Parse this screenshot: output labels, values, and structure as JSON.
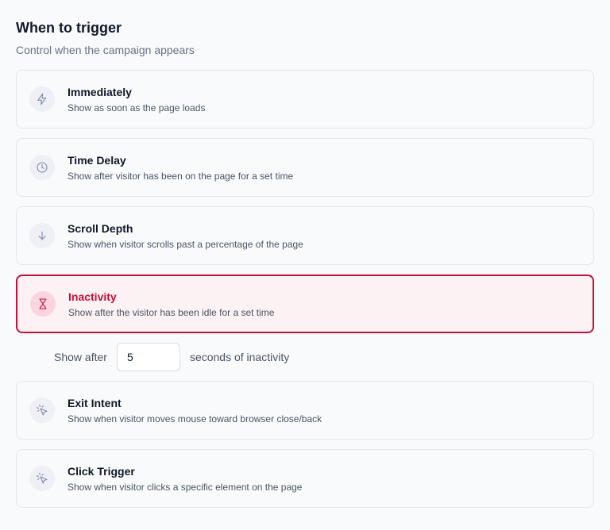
{
  "header": {
    "title": "When to trigger",
    "subtitle": "Control when the campaign appears"
  },
  "options": [
    {
      "id": "immediately",
      "icon": "lightning-icon",
      "title": "Immediately",
      "description": "Show as soon as the page loads",
      "selected": false
    },
    {
      "id": "time-delay",
      "icon": "clock-icon",
      "title": "Time Delay",
      "description": "Show after visitor has been on the page for a set time",
      "selected": false
    },
    {
      "id": "scroll-depth",
      "icon": "arrow-down-icon",
      "title": "Scroll Depth",
      "description": "Show when visitor scrolls past a percentage of the page",
      "selected": false
    },
    {
      "id": "inactivity",
      "icon": "hourglass-icon",
      "title": "Inactivity",
      "description": "Show after the visitor has been idle for a set time",
      "selected": true
    },
    {
      "id": "exit-intent",
      "icon": "cursor-click-icon",
      "title": "Exit Intent",
      "description": "Show when visitor moves mouse toward browser close/back",
      "selected": false
    },
    {
      "id": "click-trigger",
      "icon": "cursor-click-icon",
      "title": "Click Trigger",
      "description": "Show when visitor clicks a specific element on the page",
      "selected": false
    }
  ],
  "inactivity_setting": {
    "label": "Show after",
    "value": "5",
    "suffix": "seconds of inactivity"
  },
  "colors": {
    "accent": "#be123c",
    "selected_bg": "#fcf1f3"
  }
}
